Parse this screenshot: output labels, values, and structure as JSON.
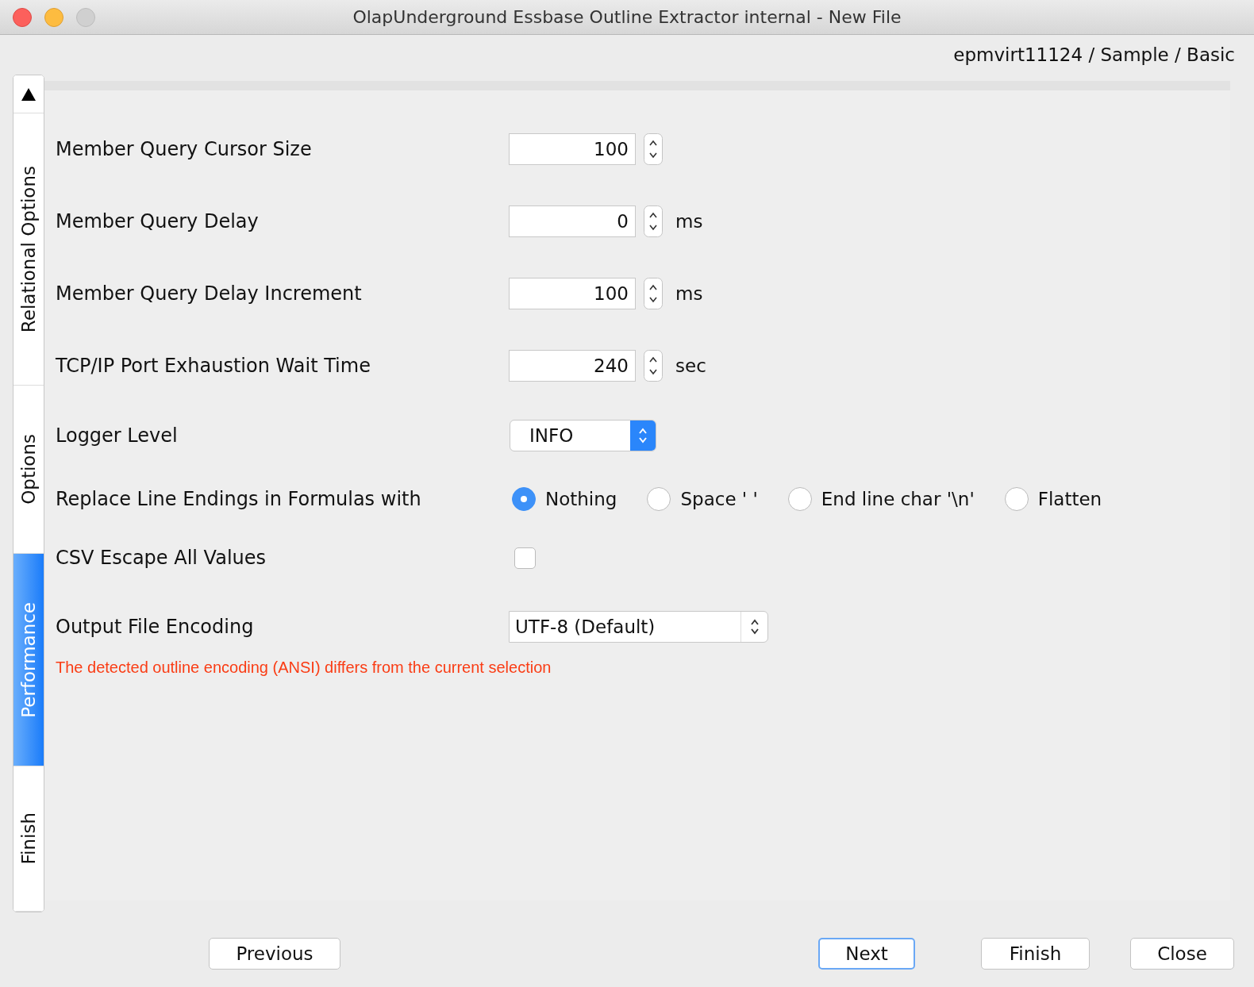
{
  "window": {
    "title": "OlapUnderground Essbase Outline Extractor internal - New File"
  },
  "breadcrumb": "epmvirt11124 / Sample / Basic",
  "tabs": [
    {
      "label": "Relational Options",
      "selected": false
    },
    {
      "label": "Options",
      "selected": false
    },
    {
      "label": "Performance",
      "selected": true
    },
    {
      "label": "Finish",
      "selected": false
    }
  ],
  "settings": [
    {
      "kind": "spinner",
      "label": "Member Query Cursor Size",
      "value": "100"
    },
    {
      "kind": "spinner",
      "label": "Member Query Delay",
      "value": "0",
      "unit": "ms"
    },
    {
      "kind": "spinner",
      "label": "Member Query Delay Increment",
      "value": "100",
      "unit": "ms"
    },
    {
      "kind": "spinner",
      "label": "TCP/IP Port Exhaustion Wait Time",
      "value": "240",
      "unit": "sec"
    },
    {
      "kind": "combo",
      "label": "Logger Level",
      "value": "INFO"
    },
    {
      "kind": "radio",
      "label": "Replace Line Endings in Formulas with",
      "options": [
        {
          "label": "Nothing",
          "selected": true
        },
        {
          "label": "Space ' '",
          "selected": false
        },
        {
          "label": "End line char '\\n'",
          "selected": false
        },
        {
          "label": "Flatten",
          "selected": false
        }
      ]
    },
    {
      "kind": "checkbox",
      "label": "CSV Escape All Values",
      "checked": false
    },
    {
      "kind": "select",
      "label": "Output File Encoding",
      "value": "UTF-8 (Default)"
    }
  ],
  "warning": "The detected outline encoding (ANSI) differs from the current selection",
  "buttons": [
    {
      "label": "Previous",
      "default": false
    },
    {
      "label": "Next",
      "default": true
    },
    {
      "label": "Finish",
      "default": false
    },
    {
      "label": "Close",
      "default": false
    }
  ]
}
